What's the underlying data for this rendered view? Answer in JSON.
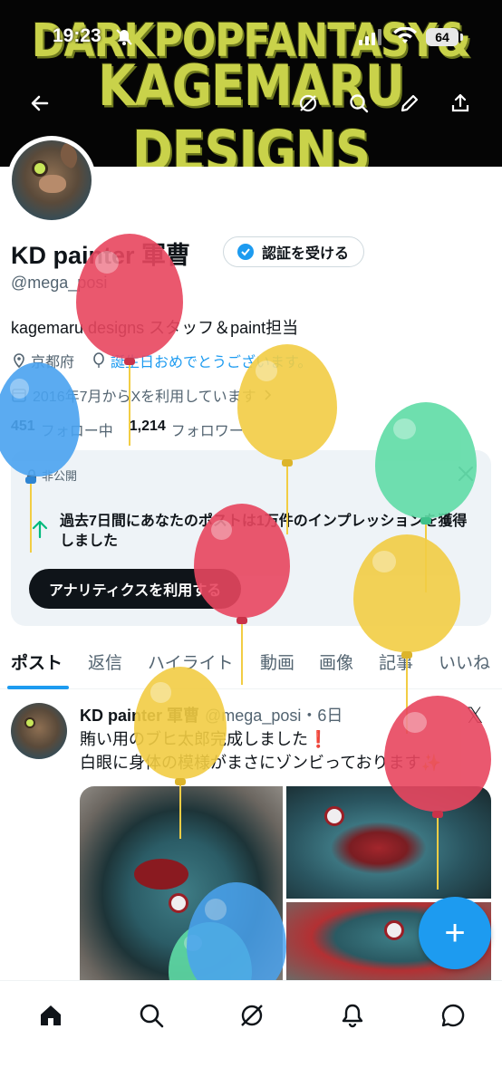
{
  "status_bar": {
    "time": "19:23",
    "battery": "64"
  },
  "banner": {
    "line1": "DARKPOPFANTASY&",
    "line2": "KAGEMARU DESIGNS"
  },
  "profile": {
    "display_name": "KD painter 軍曹",
    "verify_label": "認証を受ける",
    "handle": "@mega_posi",
    "bio": "kagemaru designs スタッフ＆paint担当",
    "location": "京都府",
    "birthday": "誕生日おめでとうございます。",
    "joined": "2016年7月からXを利用しています",
    "following_count": "451",
    "following_label": "フォロー中",
    "followers_count": "1,214",
    "followers_label": "フォロワー"
  },
  "analytics_card": {
    "private_label": "非公開",
    "message": "過去7日間にあなたのポストは1万件のインプレッションを獲得しました",
    "button_label": "アナリティクスを利用する"
  },
  "tabs": [
    "ポスト",
    "返信",
    "ハイライト",
    "動画",
    "画像",
    "記事",
    "いいね"
  ],
  "post": {
    "author": "KD painter 軍曹",
    "handle_time": "@mega_posi・6日",
    "line1": "賄い用のブヒ太郎完成しました❗️",
    "line2": "白眼に身体の模様がまさにゾンビっております✨"
  },
  "fab_label": "+",
  "bottom_nav": [
    "home-icon",
    "search-icon",
    "grok-icon",
    "notifications-icon",
    "messages-icon"
  ],
  "colors": {
    "accent": "#1d9bf0",
    "balloon_red": "#e8465f",
    "balloon_yellow": "#f2cd44",
    "balloon_blue": "#4aa3f0",
    "balloon_green": "#5fdca6"
  }
}
